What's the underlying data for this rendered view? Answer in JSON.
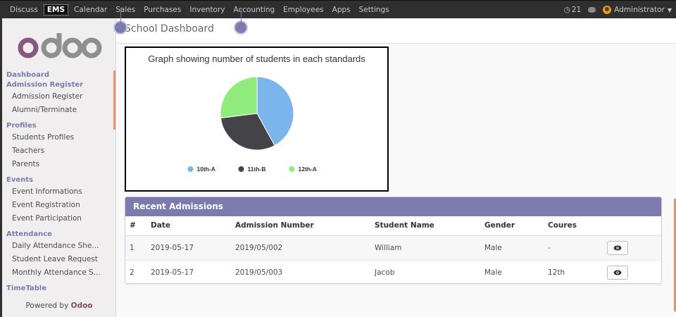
{
  "topbar": {
    "menu": [
      "Discuss",
      "EMS",
      "Calendar",
      "Sales",
      "Purchases",
      "Inventory",
      "Accounting",
      "Employees",
      "Apps",
      "Settings"
    ],
    "active": "EMS",
    "notifications": "21",
    "user": "Administrator"
  },
  "sidebar": {
    "logo_text": "odoo",
    "sections": [
      {
        "title": "Dashboard",
        "items": []
      },
      {
        "title": "Admission Register",
        "items": [
          "Admission Register",
          "Alumni/Terminate"
        ]
      },
      {
        "title": "Profiles",
        "items": [
          "Students Profiles",
          "Teachers",
          "Parents"
        ]
      },
      {
        "title": "Events",
        "items": [
          "Event Informations",
          "Event Registration",
          "Event Participation"
        ]
      },
      {
        "title": "Attendance",
        "items": [
          "Daily Attendance She...",
          "Student Leave Request",
          "Monthly Attendance S..."
        ]
      },
      {
        "title": "TimeTable",
        "items": []
      }
    ],
    "powered_prefix": "Powered by",
    "powered_brand": "Odoo"
  },
  "breadcrumb": "School Dashboard",
  "chart": {
    "title": "Graph showing number of students in each standards"
  },
  "chart_data": {
    "type": "pie",
    "title": "Graph showing number of students in each standards",
    "categories": [
      "10th-A",
      "11th-B",
      "12th-A"
    ],
    "values": [
      42,
      31,
      27
    ],
    "colors": [
      "#7cb5ec",
      "#434348",
      "#90ed7d"
    ],
    "legend_position": "bottom"
  },
  "admissions": {
    "title": "Recent Admissions",
    "columns": [
      "#",
      "Date",
      "Admission Number",
      "Student Name",
      "Gender",
      "Coures"
    ],
    "rows": [
      [
        "1",
        "2019-05-17",
        "2019/05/002",
        "William",
        "Male",
        "-"
      ],
      [
        "2",
        "2019-05-17",
        "2019/05/003",
        "Jacob",
        "Male",
        "12th"
      ]
    ]
  },
  "colors": {
    "topbar": "#2f2f2f",
    "accent": "#7c7bad",
    "brand": "#875a7b",
    "orange": "#e8916b"
  }
}
